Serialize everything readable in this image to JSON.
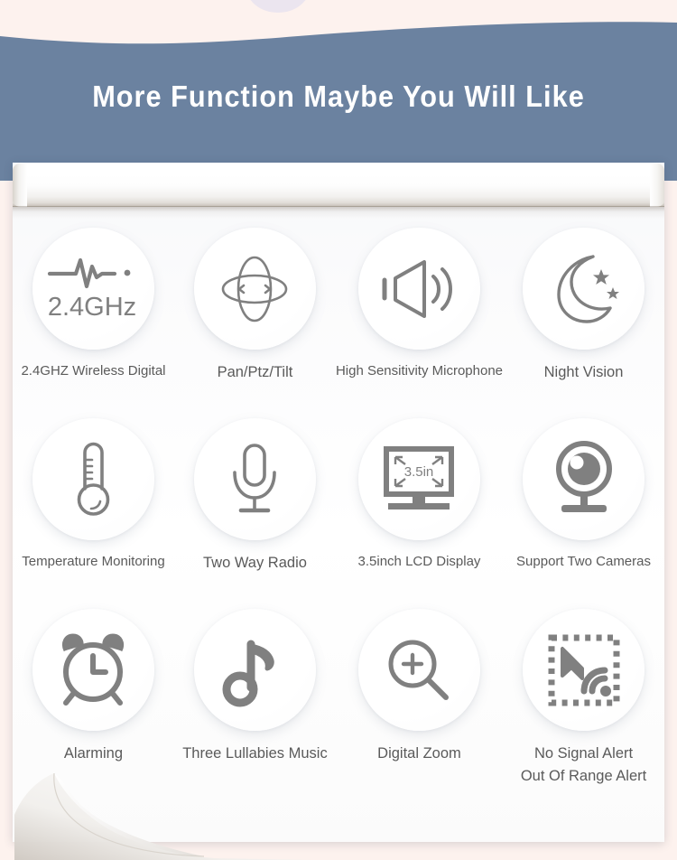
{
  "header": {
    "title": "More Function Maybe You Will Like",
    "band_color": "#6b82a0",
    "strip_color": "#fdf2ee"
  },
  "theme": {
    "icon_color": "#808080",
    "caption_color": "#5a5a5a",
    "paper_color": "#ffffff"
  },
  "features": [
    {
      "icon": "wifi-24ghz-waveform-icon",
      "icon_text": "2.4GHz",
      "label": "2.4GHZ Wireless Digital",
      "label2": ""
    },
    {
      "icon": "pan-tilt-rotation-icon",
      "icon_text": "",
      "label": "Pan/Ptz/Tilt",
      "label2": ""
    },
    {
      "icon": "speaker-sound-icon",
      "icon_text": "",
      "label": "High Sensitivity Microphone",
      "label2": ""
    },
    {
      "icon": "moon-stars-icon",
      "icon_text": "",
      "label": "Night Vision",
      "label2": ""
    },
    {
      "icon": "thermometer-icon",
      "icon_text": "",
      "label": "Temperature Monitoring",
      "label2": ""
    },
    {
      "icon": "microphone-icon",
      "icon_text": "",
      "label": "Two Way Radio",
      "label2": ""
    },
    {
      "icon": "lcd-monitor-icon",
      "icon_text": "3.5in",
      "label": "3.5inch LCD Display",
      "label2": ""
    },
    {
      "icon": "webcam-icon",
      "icon_text": "",
      "label": "Support Two Cameras",
      "label2": ""
    },
    {
      "icon": "alarm-clock-icon",
      "icon_text": "",
      "label": "Alarming",
      "label2": ""
    },
    {
      "icon": "music-note-icon",
      "icon_text": "",
      "label": "Three Lullabies Music",
      "label2": ""
    },
    {
      "icon": "magnifier-plus-icon",
      "icon_text": "",
      "label": "Digital Zoom",
      "label2": ""
    },
    {
      "icon": "no-signal-alert-icon",
      "icon_text": "",
      "label": "No Signal Alert",
      "label2": "Out Of Range Alert"
    }
  ]
}
